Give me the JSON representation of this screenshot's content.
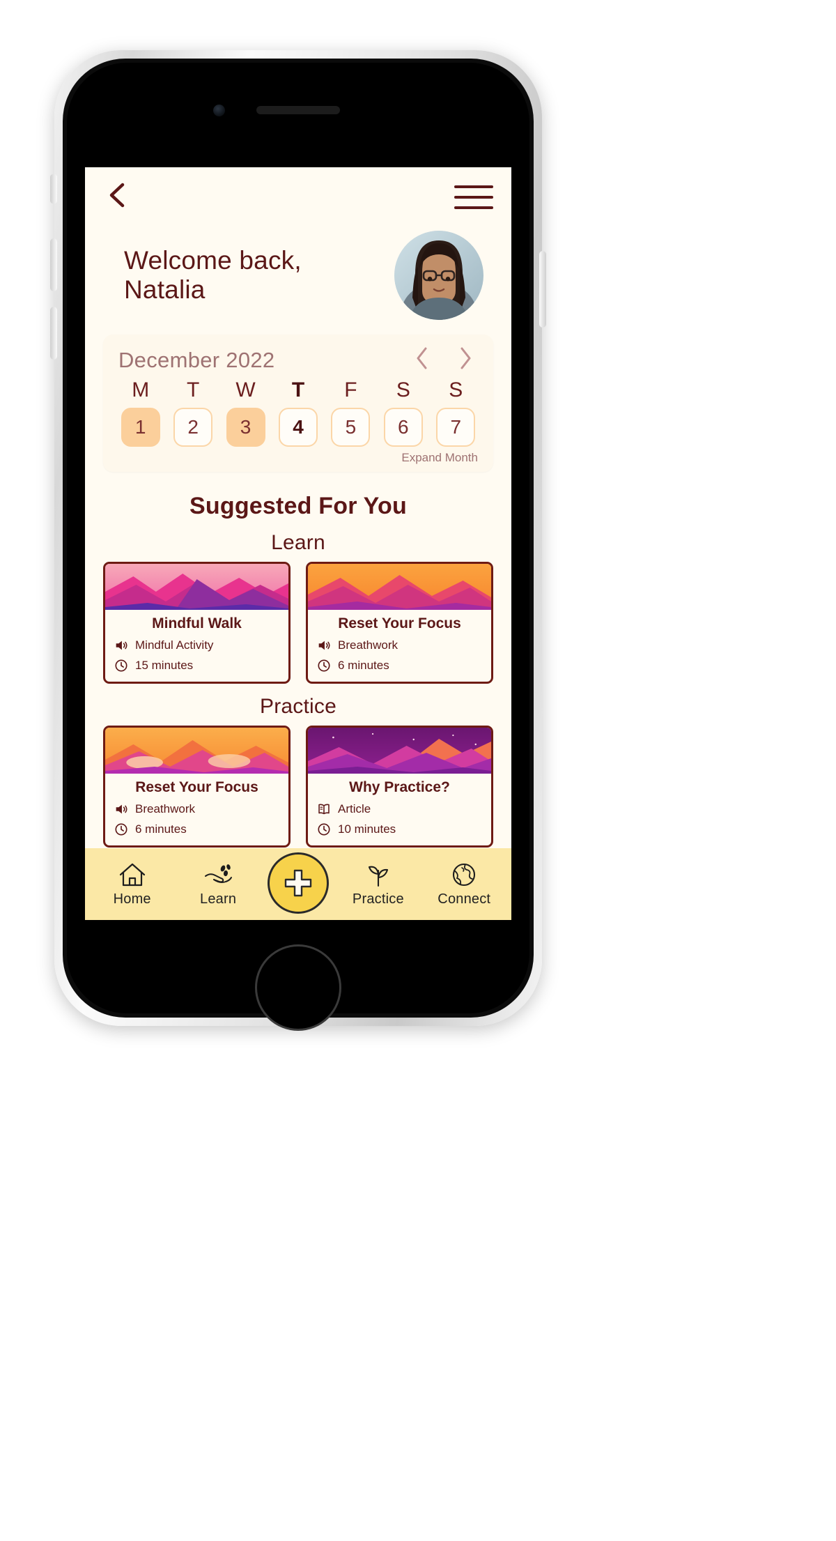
{
  "app": {
    "background_color": "#FFFBF2",
    "accent_maroon": "#5B1717",
    "accent_peach": "#FBCF9B",
    "accent_yellow": "#FBE8A6"
  },
  "header": {
    "back_icon": "chevron-left-icon",
    "menu_icon": "hamburger-menu-icon",
    "greeting_line1": "Welcome back,",
    "greeting_line2": "Natalia",
    "avatar_alt": "user-avatar"
  },
  "calendar": {
    "month_label": "December 2022",
    "prev_icon": "chevron-left-icon",
    "next_icon": "chevron-right-icon",
    "expand_label": "Expand Month",
    "day_initials": [
      "M",
      "T",
      "W",
      "T",
      "F",
      "S",
      "S"
    ],
    "today_index": 3,
    "days": [
      {
        "number": "1",
        "state": "filled"
      },
      {
        "number": "2",
        "state": "outlined"
      },
      {
        "number": "3",
        "state": "filled"
      },
      {
        "number": "4",
        "state": "outlined"
      },
      {
        "number": "5",
        "state": "outlined"
      },
      {
        "number": "6",
        "state": "outlined"
      },
      {
        "number": "7",
        "state": "outlined"
      }
    ]
  },
  "suggested": {
    "title": "Suggested For You",
    "sections": [
      {
        "label": "Learn",
        "cards": [
          {
            "title": "Mindful Walk",
            "type_icon": "speaker-icon",
            "type_label": "Mindful Activity",
            "duration_icon": "clock-icon",
            "duration_label": "15 minutes",
            "art": "pink-mountains"
          },
          {
            "title": "Reset Your Focus",
            "type_icon": "speaker-icon",
            "type_label": "Breathwork",
            "duration_icon": "clock-icon",
            "duration_label": "6 minutes",
            "art": "orange-mountains"
          }
        ]
      },
      {
        "label": "Practice",
        "cards": [
          {
            "title": "Reset Your Focus",
            "type_icon": "speaker-icon",
            "type_label": "Breathwork",
            "duration_icon": "clock-icon",
            "duration_label": "6 minutes",
            "art": "orange-mountains"
          },
          {
            "title": "Why Practice?",
            "type_icon": "book-icon",
            "type_label": "Article",
            "duration_icon": "clock-icon",
            "duration_label": "10 minutes",
            "art": "purple-mountains"
          }
        ]
      }
    ]
  },
  "bottom_nav": {
    "items": [
      {
        "label": "Home",
        "icon": "home-icon"
      },
      {
        "label": "Learn",
        "icon": "hand-sprout-icon"
      },
      {
        "label": "Practice",
        "icon": "plant-leaf-icon"
      },
      {
        "label": "Connect",
        "icon": "globe-icon"
      }
    ],
    "fab_icon": "plus-icon"
  }
}
